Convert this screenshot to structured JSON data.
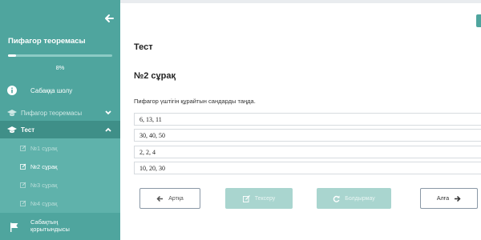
{
  "sidebar": {
    "course_title": "Пифагор теоремасы",
    "progress": {
      "value_percent": 8,
      "text": "8%"
    },
    "nav": {
      "lesson_overview": "Сабаққа шолу",
      "theorem": "Пифагор теоремасы",
      "test": "Тест",
      "lesson_summary": "Сабақтың қорытындысы"
    },
    "test_items": [
      {
        "label": "№1 сұрақ",
        "active": false
      },
      {
        "label": "№2 сұрақ",
        "active": true
      },
      {
        "label": "№3 сұрақ",
        "active": false
      },
      {
        "label": "№4 сұрақ",
        "active": false
      }
    ]
  },
  "main": {
    "page_title": "Тест",
    "question_title": "№2 сұрақ",
    "question_text": "Пифагор үштігін құрайтын сандарды таңда.",
    "options": [
      "6, 13, 11",
      "30, 40, 50",
      "2, 2, 4",
      "10, 20, 30"
    ],
    "buttons": {
      "back": "Артқа",
      "check": "Тексеру",
      "cancel": "Болдырмау",
      "next": "Алға"
    }
  },
  "colors": {
    "sidebar": "#4fa59e",
    "sidebar_active": "#3f8f88",
    "sub_panel": "#5fb2ab",
    "disabled_button": "#a9d5cf"
  },
  "icons": {
    "back": "arrow-left-icon",
    "lesson": "info-icon",
    "test": "graduation-cap-icon",
    "question": "pencil-square-icon",
    "summary": "flag-icon",
    "check": "edit-icon",
    "cancel": "undo-icon",
    "next": "arrow-right-icon"
  }
}
